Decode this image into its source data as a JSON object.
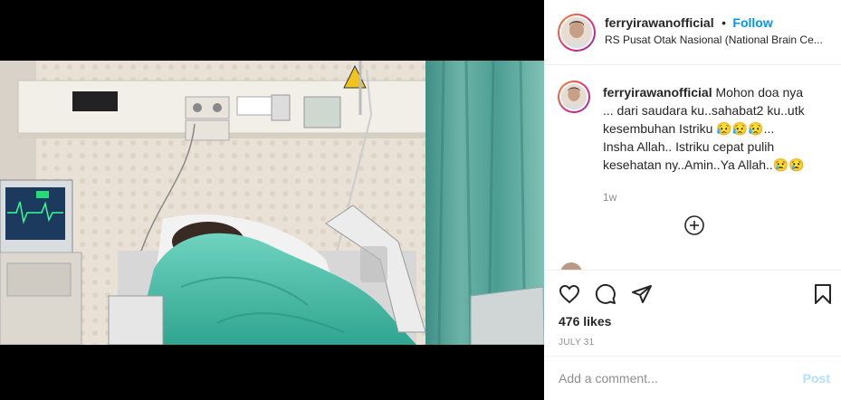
{
  "header": {
    "username": "ferryirawanofficial",
    "separator": "•",
    "follow_label": "Follow",
    "location": "RS Pusat Otak Nasional (National Brain Ce..."
  },
  "caption": {
    "username": "ferryirawanofficial",
    "lines": [
      "Mohon doa nya",
      "... dari saudara ku..sahabat2 ku..utk",
      "kesembuhan Istriku 😥😥😥...",
      "Insha Allah.. Istriku cepat pulih",
      "kesehatan ny..Amin..Ya Allah..😢😢"
    ],
    "time_ago": "1w"
  },
  "actions": {
    "likes": "476 likes",
    "date": "JULY 31",
    "like_icon": "heart-icon",
    "comment_icon": "comment-bubble-icon",
    "share_icon": "paper-plane-icon",
    "save_icon": "bookmark-icon",
    "load_more_icon": "plus-circle-icon"
  },
  "comment": {
    "placeholder": "Add a comment...",
    "post_label": "Post"
  },
  "colors": {
    "accent": "#0095f6",
    "post_disabled": "#b2dffc",
    "muted": "#8e8e8e"
  }
}
